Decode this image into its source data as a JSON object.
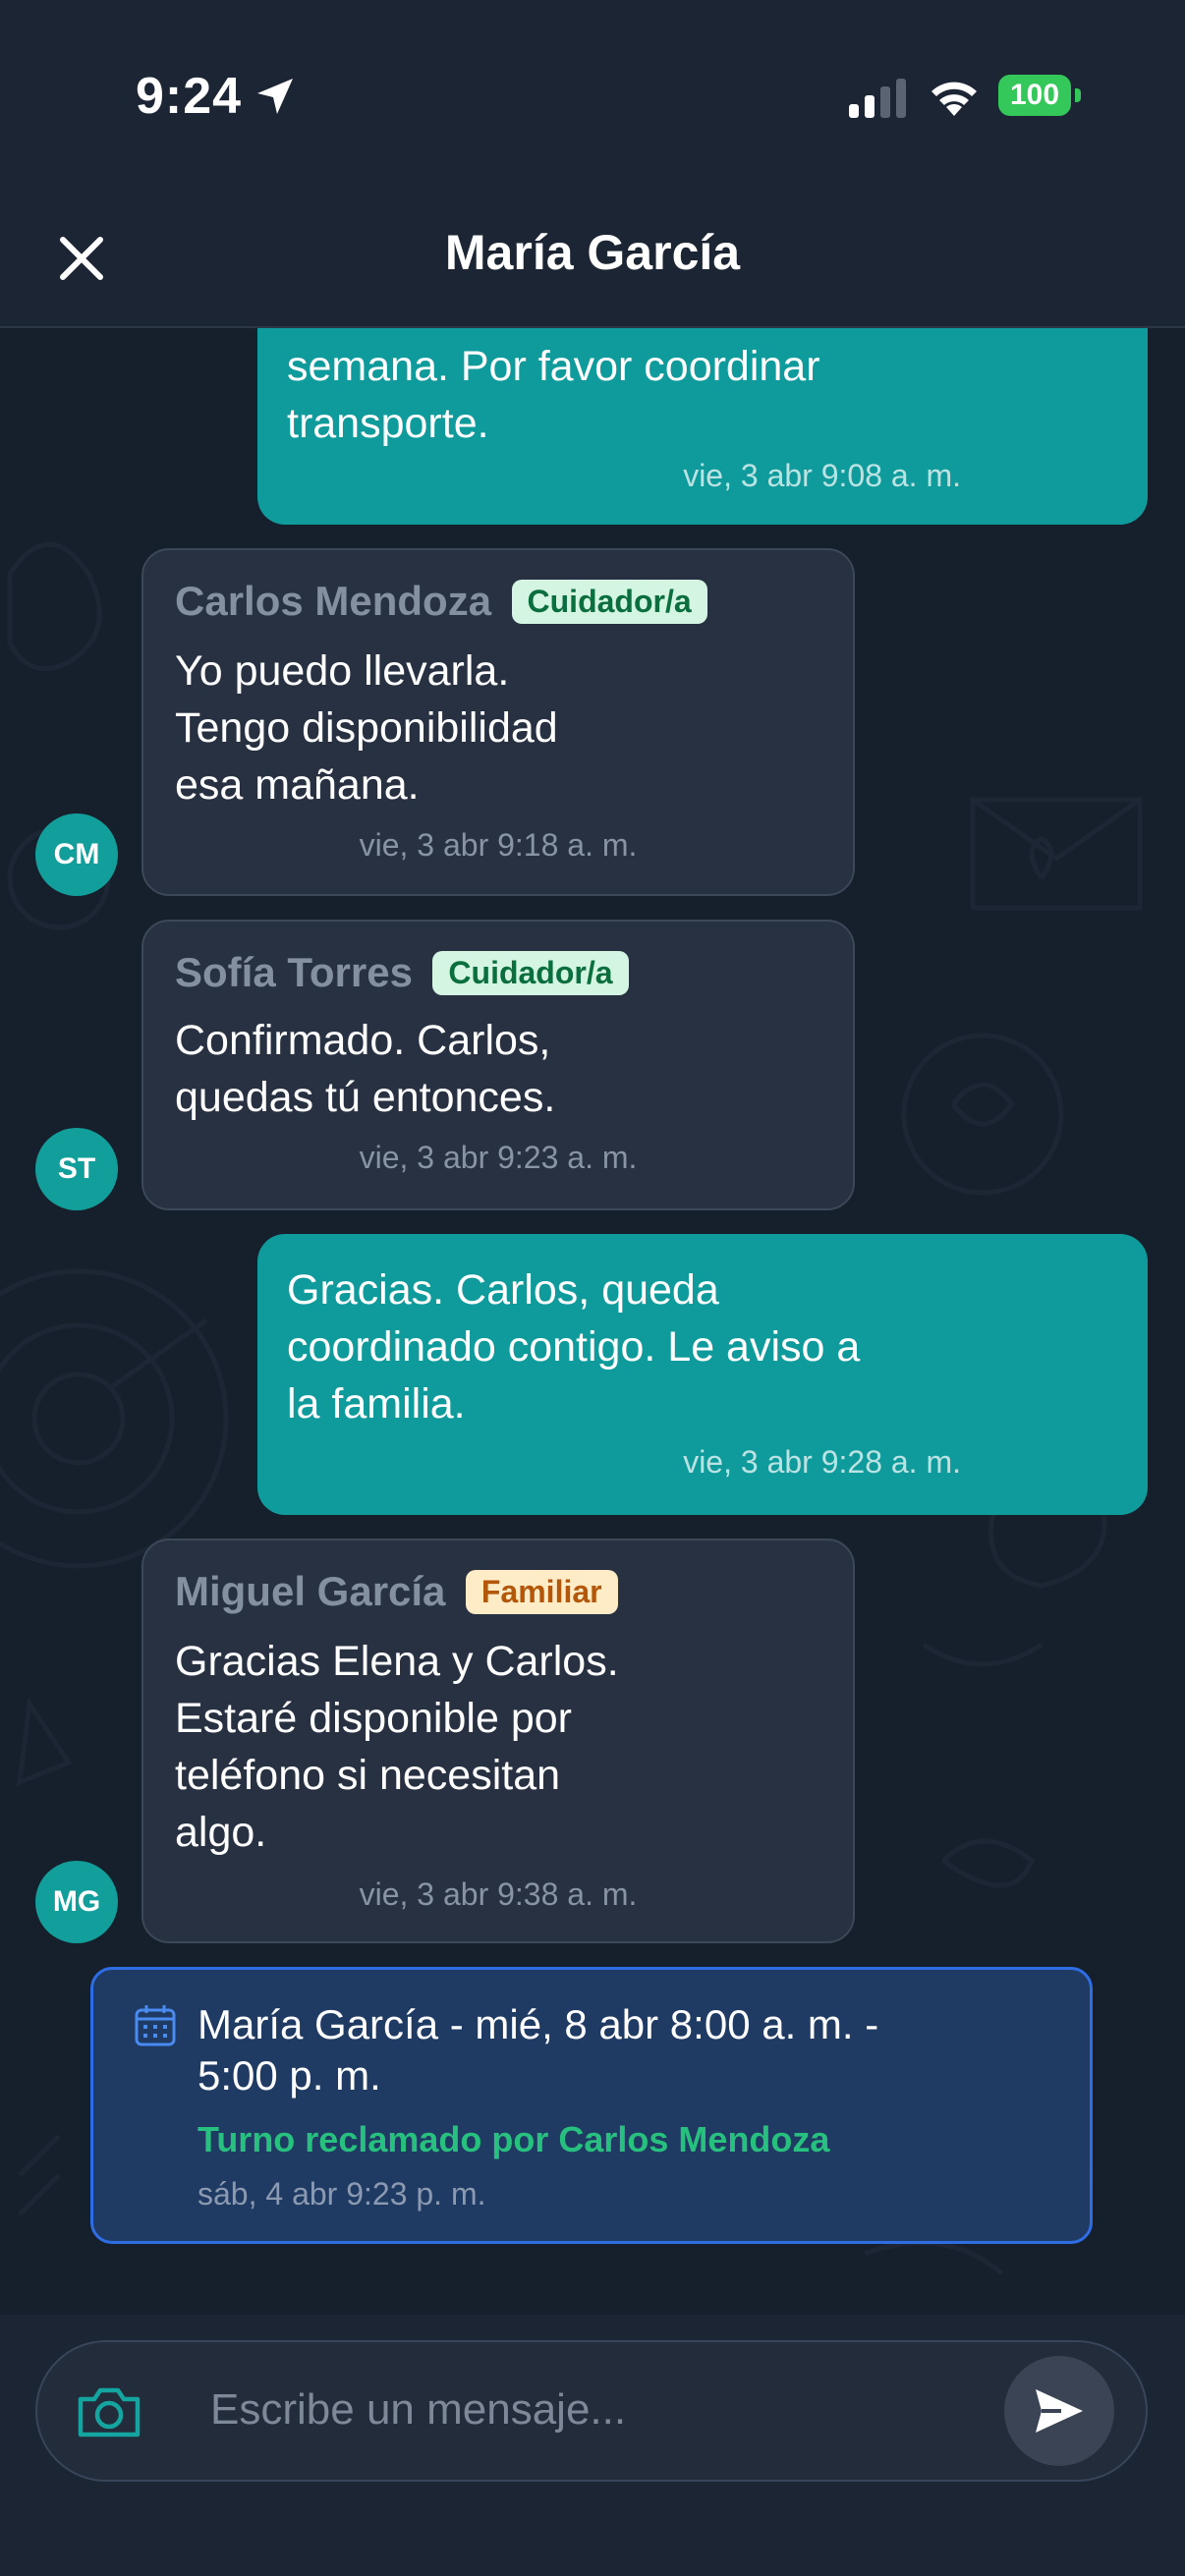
{
  "status_bar": {
    "time": "9:24",
    "battery": "100",
    "icons": [
      "location-arrow-icon",
      "cellular-signal-icon",
      "wifi-icon",
      "battery-icon"
    ]
  },
  "header": {
    "title": "María García",
    "close_icon": "close-icon"
  },
  "messages": [
    {
      "direction": "out",
      "lines": [
        "semana. Por favor coordinar",
        "transporte."
      ],
      "time": "vie, 3 abr 9:08 a. m."
    },
    {
      "direction": "in",
      "sender": "Carlos Mendoza",
      "role": "Cuidador/a",
      "initials": "CM",
      "lines": [
        "Yo puedo llevarla.",
        "Tengo disponibilidad",
        "esa mañana."
      ],
      "time": "vie, 3 abr 9:18 a. m."
    },
    {
      "direction": "in",
      "sender": "Sofía Torres",
      "role": "Cuidador/a",
      "initials": "ST",
      "lines": [
        "Confirmado. Carlos,",
        "quedas tú entonces."
      ],
      "time": "vie, 3 abr 9:23 a. m."
    },
    {
      "direction": "out",
      "lines": [
        "Gracias. Carlos, queda",
        "coordinado contigo. Le aviso a",
        "la familia."
      ],
      "time": "vie, 3 abr 9:28 a. m."
    },
    {
      "direction": "in",
      "sender": "Miguel García",
      "role": "Familiar",
      "initials": "MG",
      "lines": [
        "Gracias Elena y Carlos.",
        "Estaré disponible por",
        "teléfono si necesitan",
        "algo."
      ],
      "time": "vie, 3 abr 9:38 a. m."
    }
  ],
  "shift_card": {
    "icon": "calendar-icon",
    "title_lines": [
      "María García - mié, 8 abr 8:00 a. m. -",
      "5:00 p. m."
    ],
    "status": "Turno reclamado por Carlos Mendoza",
    "time": "sáb, 4 abr 9:23 p. m."
  },
  "composer": {
    "placeholder": "Escribe un mensaje...",
    "camera_icon": "camera-icon",
    "send_icon": "send-icon"
  },
  "colors": {
    "outgoing_bubble": "#0f9b9b",
    "incoming_bubble": "#273141",
    "background": "#161f2c",
    "accent_blue": "#2f6de5",
    "claimed_green": "#27c07e"
  }
}
